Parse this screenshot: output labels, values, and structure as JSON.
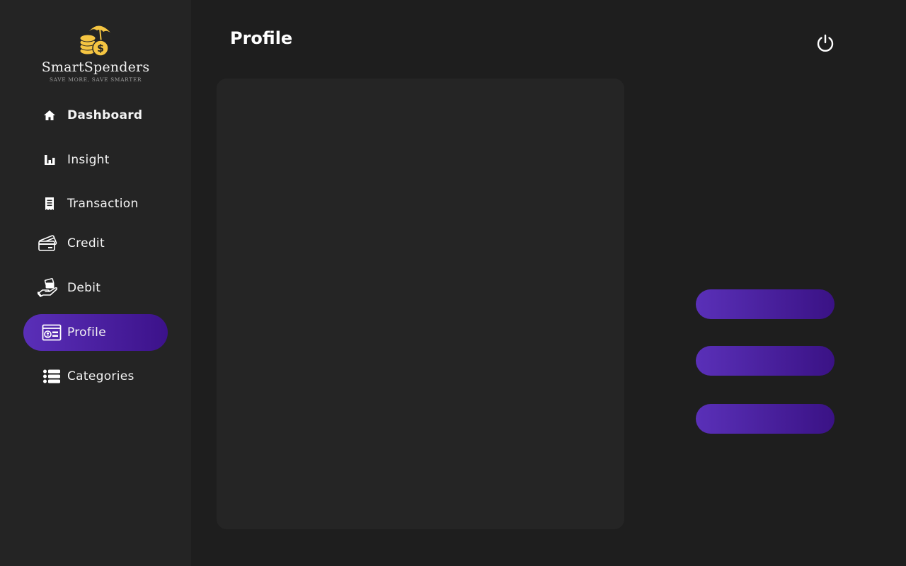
{
  "brand": {
    "name": "SmartSpenders",
    "tagline": "SAVE MORE, SAVE SMARTER",
    "logo_icon": "umbrella-coins-icon",
    "logo_color": "#f5c542"
  },
  "sidebar": {
    "items": [
      {
        "label": "Dashboard",
        "icon": "home-icon"
      },
      {
        "label": "Insight",
        "icon": "bar-chart-icon"
      },
      {
        "label": "Transaction",
        "icon": "receipt-icon"
      },
      {
        "label": "Credit",
        "icon": "credit-card-icon"
      },
      {
        "label": "Debit",
        "icon": "hand-card-icon"
      },
      {
        "label": "Profile",
        "icon": "profile-card-icon",
        "active": true
      },
      {
        "label": "Categories",
        "icon": "list-icon"
      }
    ]
  },
  "header": {
    "title": "Profile",
    "power_icon": "power-icon"
  },
  "actions": {
    "buttons": [
      {
        "label": ""
      },
      {
        "label": ""
      },
      {
        "label": ""
      }
    ]
  },
  "colors": {
    "accent_start": "#5a2fb8",
    "accent_end": "#3c128a",
    "sidebar_bg": "#242424",
    "page_bg": "#1e1e1e",
    "card_bg": "#252525"
  }
}
